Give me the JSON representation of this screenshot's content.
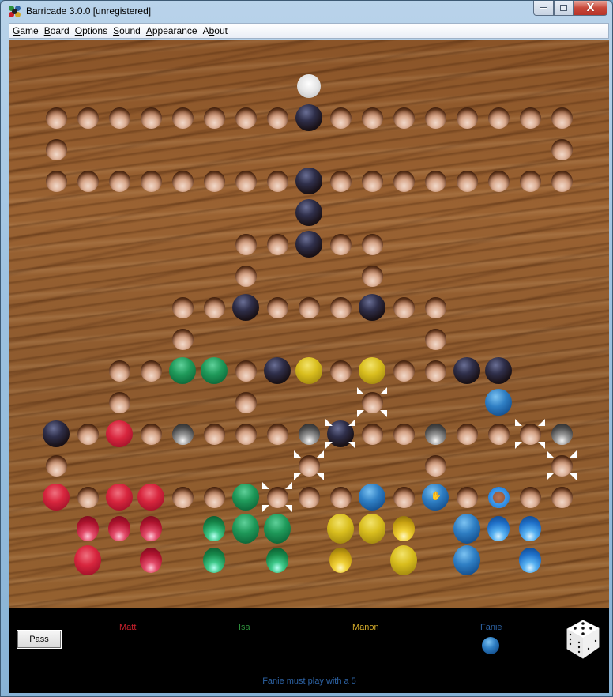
{
  "window": {
    "title": "Barricade 3.0.0 [unregistered]",
    "controls": {
      "minimize": "minimize",
      "maximize": "maximize",
      "close": "X"
    }
  },
  "menu": [
    {
      "label": "Game",
      "accel": "G"
    },
    {
      "label": "Board",
      "accel": "B"
    },
    {
      "label": "Options",
      "accel": "O"
    },
    {
      "label": "Sound",
      "accel": "S"
    },
    {
      "label": "Appearance",
      "accel": "A"
    },
    {
      "label": "About",
      "accel": "b"
    }
  ],
  "colors": {
    "matt": "#c8202c",
    "isa": "#2e8f3c",
    "manon": "#d2aa2a",
    "fanie": "#2d63a5",
    "status": "#2d63a5"
  },
  "board": {
    "holes_grid": {
      "rows": [
        {
          "row": 1,
          "cols": [
            0,
            1,
            2,
            3,
            4,
            5,
            6,
            7,
            8,
            9,
            10,
            11,
            12,
            13,
            14,
            15,
            16
          ]
        },
        {
          "row": 2,
          "cols": [
            0,
            16
          ]
        },
        {
          "row": 3,
          "cols": [
            0,
            1,
            2,
            3,
            4,
            5,
            6,
            7,
            8,
            9,
            10,
            11,
            12,
            13,
            14,
            15,
            16
          ]
        },
        {
          "row": 4,
          "cols": [
            8
          ]
        },
        {
          "row": 5,
          "cols": [
            6,
            7,
            8,
            9,
            10
          ]
        },
        {
          "row": 6,
          "cols": [
            6,
            10
          ]
        },
        {
          "row": 7,
          "cols": [
            4,
            5,
            6,
            7,
            8,
            9,
            10,
            11,
            12
          ]
        },
        {
          "row": 8,
          "cols": [
            4,
            12
          ]
        },
        {
          "row": 9,
          "cols": [
            2,
            3,
            4,
            5,
            6,
            7,
            8,
            9,
            10,
            11,
            12,
            13,
            14
          ]
        },
        {
          "row": 10,
          "cols": [
            2,
            6,
            10,
            14
          ]
        },
        {
          "row": 11,
          "cols": [
            0,
            1,
            2,
            3,
            4,
            5,
            6,
            7,
            8,
            9,
            10,
            11,
            12,
            13,
            14,
            15,
            16
          ]
        },
        {
          "row": 12,
          "cols": [
            0,
            8,
            12,
            16
          ]
        },
        {
          "row": 13,
          "cols": [
            0,
            1,
            2,
            3,
            4,
            5,
            6,
            7,
            8,
            9,
            10,
            11,
            12,
            13,
            14,
            15,
            16
          ]
        }
      ]
    },
    "pieces": [
      {
        "type": "goal",
        "color": "white",
        "row": 0,
        "col": 8
      },
      {
        "type": "barricade",
        "color": "black",
        "row": 1,
        "col": 8
      },
      {
        "type": "barricade",
        "color": "black",
        "row": 3,
        "col": 8
      },
      {
        "type": "barricade",
        "color": "black",
        "row": 4,
        "col": 8
      },
      {
        "type": "barricade",
        "color": "black",
        "row": 5,
        "col": 8
      },
      {
        "type": "barricade",
        "color": "black",
        "row": 7,
        "col": 6
      },
      {
        "type": "barricade",
        "color": "black",
        "row": 7,
        "col": 10
      },
      {
        "type": "pawn",
        "color": "green",
        "row": 9,
        "col": 4
      },
      {
        "type": "pawn",
        "color": "green",
        "row": 9,
        "col": 5
      },
      {
        "type": "barricade",
        "color": "black",
        "row": 9,
        "col": 7
      },
      {
        "type": "pawn",
        "color": "yellow",
        "row": 9,
        "col": 8
      },
      {
        "type": "pawn",
        "color": "yellow",
        "row": 9,
        "col": 10
      },
      {
        "type": "barricade",
        "color": "black",
        "row": 9,
        "col": 13
      },
      {
        "type": "barricade",
        "color": "black",
        "row": 9,
        "col": 14
      },
      {
        "type": "pawn",
        "color": "blue",
        "row": 10,
        "col": 14
      },
      {
        "type": "barricade",
        "color": "black",
        "row": 11,
        "col": 0
      },
      {
        "type": "pawn",
        "color": "red",
        "row": 11,
        "col": 2
      },
      {
        "type": "empty-barricade-slot",
        "color": "grey",
        "row": 11,
        "col": 4
      },
      {
        "type": "empty-barricade-slot",
        "color": "grey",
        "row": 11,
        "col": 8
      },
      {
        "type": "barricade",
        "color": "black",
        "row": 11,
        "col": 9
      },
      {
        "type": "empty-barricade-slot",
        "color": "grey",
        "row": 11,
        "col": 12
      },
      {
        "type": "empty-barricade-slot",
        "color": "grey",
        "row": 11,
        "col": 16
      },
      {
        "type": "pawn",
        "color": "red",
        "row": 13,
        "col": 0
      },
      {
        "type": "pawn",
        "color": "red",
        "row": 13,
        "col": 2
      },
      {
        "type": "pawn",
        "color": "red",
        "row": 13,
        "col": 3
      },
      {
        "type": "pawn",
        "color": "green",
        "row": 13,
        "col": 6
      },
      {
        "type": "pawn",
        "color": "blue",
        "row": 13,
        "col": 10
      },
      {
        "type": "pawn",
        "color": "blue",
        "row": 13,
        "col": 12,
        "selected": true,
        "cursor": "hand"
      },
      {
        "type": "start-ring",
        "color": "blue",
        "row": 13,
        "col": 14
      }
    ],
    "home": {
      "red": [
        {
          "r": 0,
          "c": 0
        },
        {
          "r": 0,
          "c": 1
        },
        {
          "r": 0,
          "c": 2
        },
        {
          "r": 1,
          "c": 0,
          "big": true
        },
        {
          "r": 1,
          "c": 2
        }
      ],
      "green": [
        {
          "r": 0,
          "c": 0
        },
        {
          "r": 0,
          "c": 1,
          "big": true
        },
        {
          "r": 0,
          "c": 2,
          "big": true
        },
        {
          "r": 1,
          "c": 0
        },
        {
          "r": 1,
          "c": 2
        }
      ],
      "yellow": [
        {
          "r": 0,
          "c": 0,
          "big": true
        },
        {
          "r": 0,
          "c": 1,
          "big": true
        },
        {
          "r": 0,
          "c": 2
        },
        {
          "r": 1,
          "c": 0
        },
        {
          "r": 1,
          "c": 2,
          "big": true
        }
      ],
      "blue": [
        {
          "r": 0,
          "c": 0,
          "big": true
        },
        {
          "r": 0,
          "c": 1
        },
        {
          "r": 0,
          "c": 2
        },
        {
          "r": 1,
          "c": 0,
          "big": true
        },
        {
          "r": 1,
          "c": 2
        }
      ]
    },
    "highlighted_targets": [
      {
        "row": 10,
        "col": 10
      },
      {
        "row": 11,
        "col": 9
      },
      {
        "row": 12,
        "col": 8
      },
      {
        "row": 13,
        "col": 7
      },
      {
        "row": 11,
        "col": 15
      },
      {
        "row": 12,
        "col": 16
      }
    ]
  },
  "panel": {
    "pass_label": "Pass",
    "players": [
      {
        "name": "Matt",
        "color": "red"
      },
      {
        "name": "Isa",
        "color": "green"
      },
      {
        "name": "Manon",
        "color": "yellow"
      },
      {
        "name": "Fanie",
        "color": "blue",
        "current": true
      }
    ],
    "die_value": 5,
    "status": "Fanie must play with a 5"
  }
}
